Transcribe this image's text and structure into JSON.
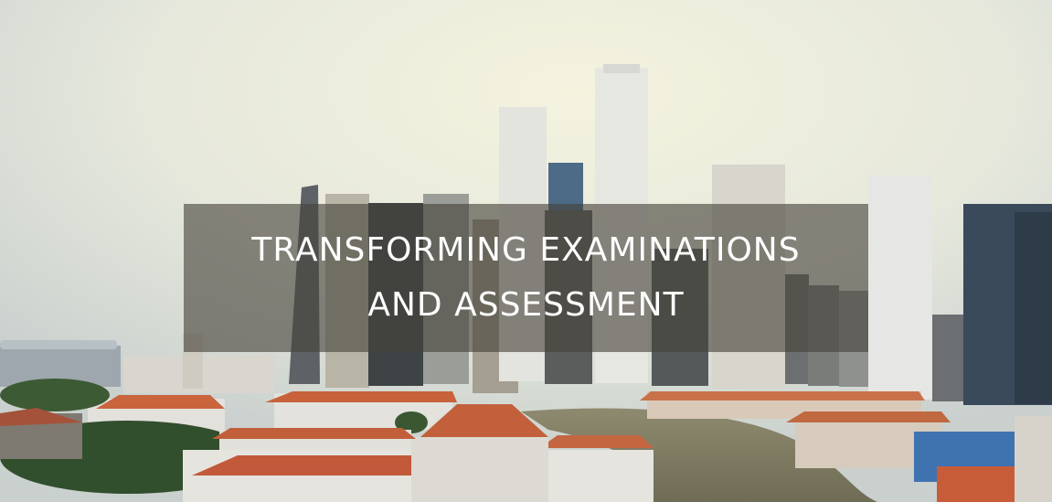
{
  "video_frame": {
    "title_lines": [
      "TRANSFORMING EXAMINATIONS",
      "AND ASSESSMENT"
    ]
  }
}
